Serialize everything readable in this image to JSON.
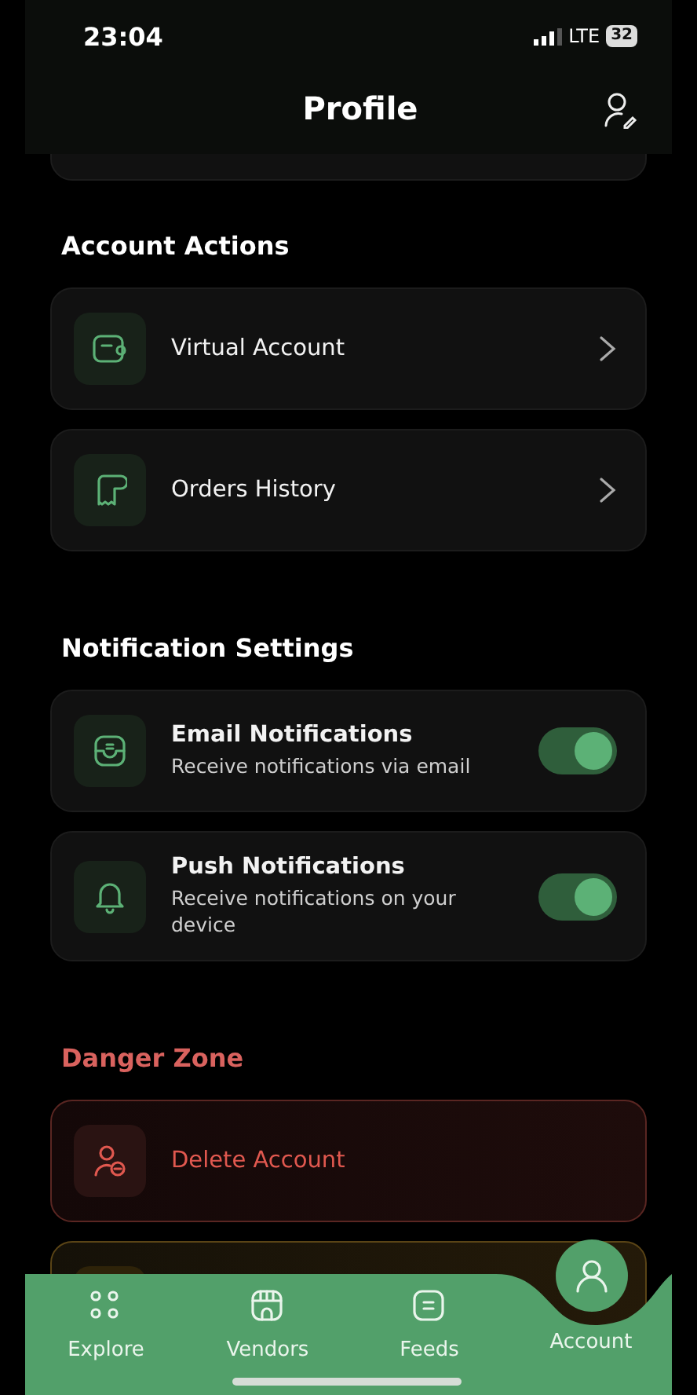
{
  "status_bar": {
    "time": "23:04",
    "network": "LTE",
    "battery": "32"
  },
  "header": {
    "title": "Profile"
  },
  "sections": [
    {
      "title": "Account Actions",
      "kind": "normal",
      "items": [
        {
          "kind": "link",
          "label": "Virtual Account"
        },
        {
          "kind": "link",
          "label": "Orders History"
        }
      ]
    },
    {
      "title": "Notification Settings",
      "kind": "normal",
      "items": [
        {
          "kind": "toggle",
          "label": "Email Notifications",
          "description": "Receive notifications via email",
          "on": true
        },
        {
          "kind": "toggle",
          "label": "Push Notifications",
          "description": "Receive notifications on your device",
          "on": true
        }
      ]
    },
    {
      "title": "Danger Zone",
      "kind": "danger",
      "items": [
        {
          "kind": "danger",
          "label": "Delete Account"
        },
        {
          "kind": "warning"
        }
      ]
    }
  ],
  "tab_bar": [
    {
      "label": "Explore",
      "selected": false
    },
    {
      "label": "Vendors",
      "selected": false
    },
    {
      "label": "Feeds",
      "selected": false
    },
    {
      "label": "Account",
      "selected": true
    }
  ]
}
